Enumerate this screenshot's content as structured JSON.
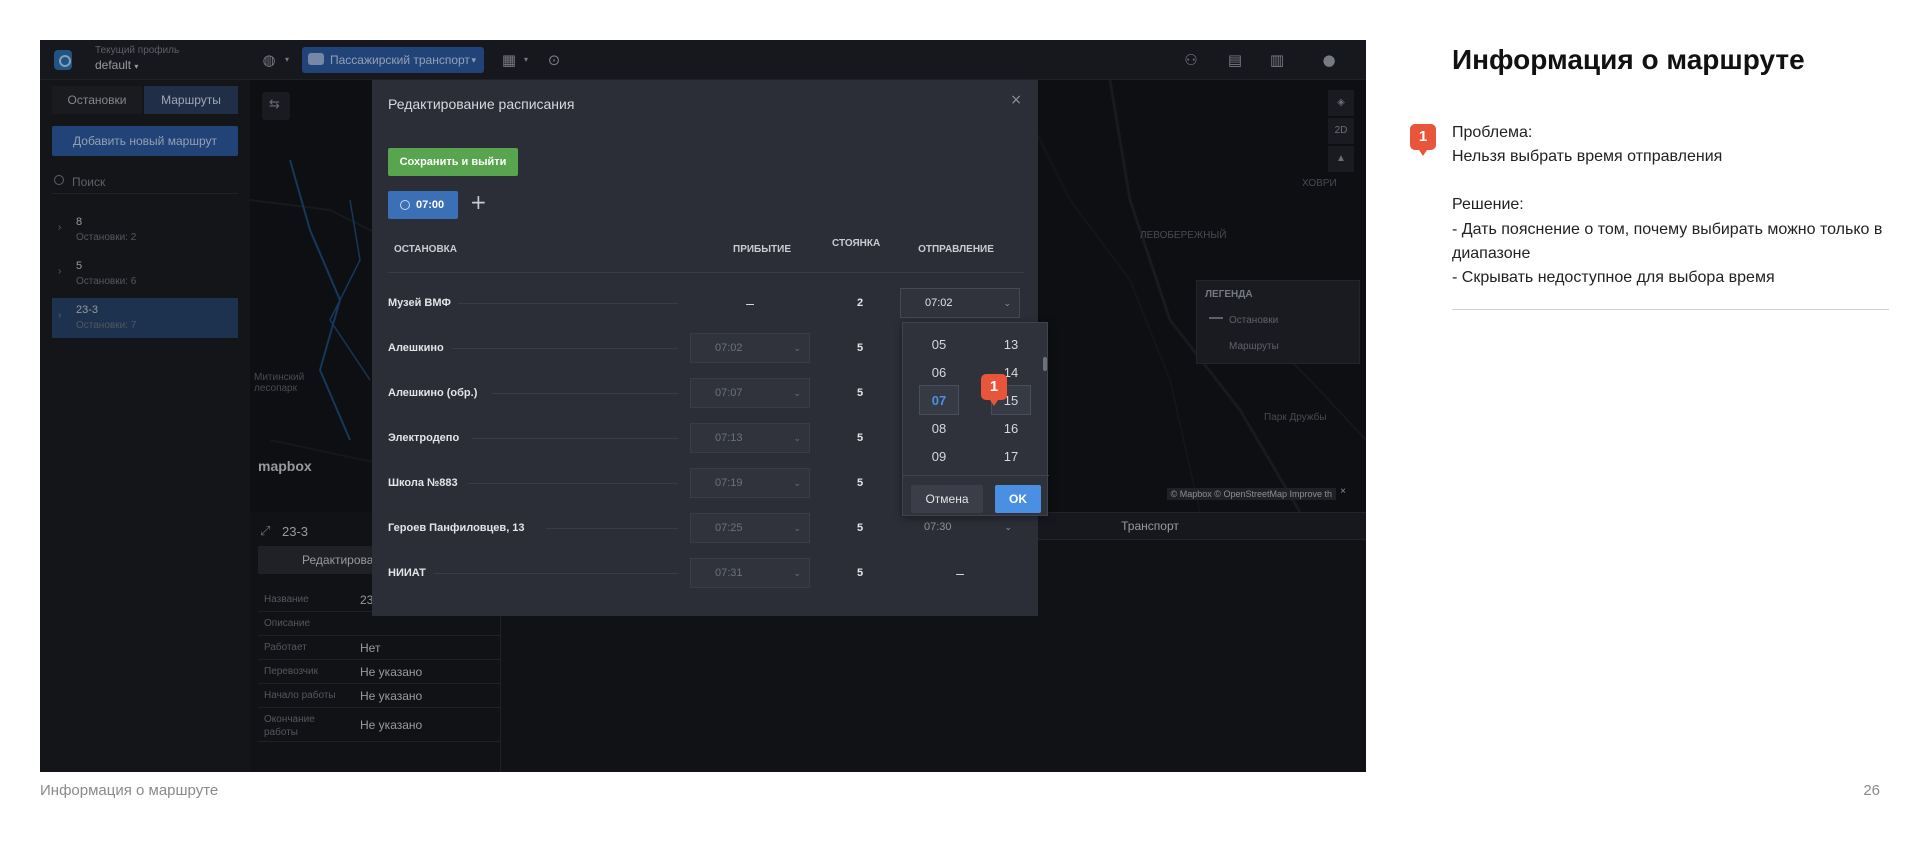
{
  "app": {
    "profile_caption": "Текущий профиль",
    "profile_value": "default",
    "transport_select": "Пассажирский транспорт",
    "icons": [
      "globe-icon",
      "bus-icon",
      "grid-icon",
      "car-search-icon",
      "users-icon",
      "archive-icon",
      "clipboard-icon",
      "user-icon"
    ]
  },
  "sidebar": {
    "tabs": [
      {
        "label": "Остановки",
        "active": false
      },
      {
        "label": "Маршруты",
        "active": true
      }
    ],
    "add_route_label": "Добавить новый маршрут",
    "search_placeholder": "Поиск",
    "routes": [
      {
        "num": "8",
        "sub": "Остановки: 2",
        "selected": false
      },
      {
        "num": "5",
        "sub": "Остановки: 6",
        "selected": false
      },
      {
        "num": "23-3",
        "sub": "Остановки: 7",
        "selected": true
      }
    ]
  },
  "map": {
    "labels": [
      "Митинский лесопарк",
      "ЛЕВОБЕРЕЖНЫЙ",
      "ХОВРИ",
      "Парк Дружбы"
    ],
    "zoom_mode": "2D",
    "legend": {
      "title": "ЛЕГЕНДА",
      "items": [
        "Остановки",
        "Маршруты"
      ]
    },
    "logo": "mapbox",
    "attribution": "© Mapbox © OpenStreetMap Improve th",
    "attribution_close": "×"
  },
  "route_panel": {
    "code": "23-3",
    "edit_label": "Редактирова",
    "transport_tab": "Транспорт",
    "fields": [
      {
        "key": "Название",
        "value": "23"
      },
      {
        "key": "Описание",
        "value": ""
      },
      {
        "key": "Работает",
        "value": "Нет"
      },
      {
        "key": "Перевозчик",
        "value": "Не указано"
      },
      {
        "key": "Начало работы",
        "value": "Не указано"
      },
      {
        "key": "Окончание работы",
        "value": "Не указано"
      }
    ]
  },
  "modal": {
    "title": "Редактирование расписания",
    "close": "×",
    "save_label": "Сохранить и выйти",
    "time_chip": "07:00",
    "add_time": "+",
    "headers": {
      "stop": "ОСТАНОВКА",
      "arrival": "ПРИБЫТИЕ",
      "stay": "СТОЯНКА",
      "departure": "ОТПРАВЛЕНИЕ"
    },
    "rows": [
      {
        "name": "Музей ВМФ",
        "arrival": "–",
        "stay": "2",
        "departure": "07:02"
      },
      {
        "name": "Алешкино",
        "arrival": "07:02",
        "stay": "5",
        "departure": ""
      },
      {
        "name": "Алешкино (обр.)",
        "arrival": "07:07",
        "stay": "5",
        "departure": ""
      },
      {
        "name": "Электродепо",
        "arrival": "07:13",
        "stay": "5",
        "departure": ""
      },
      {
        "name": "Школа №883",
        "arrival": "07:19",
        "stay": "5",
        "departure": ""
      },
      {
        "name": "Героев Панфиловцев, 13",
        "arrival": "07:25",
        "stay": "5",
        "departure": "07:30"
      },
      {
        "name": "НИИАТ",
        "arrival": "07:31",
        "stay": "5",
        "departure": "–"
      }
    ]
  },
  "picker": {
    "hours": [
      "05",
      "06",
      "07",
      "08",
      "09"
    ],
    "selected_hour": "07",
    "minutes": [
      "13",
      "14",
      "15",
      "16",
      "17"
    ],
    "cancel_label": "Отмена",
    "ok_label": "OK"
  },
  "markers": {
    "label": "1"
  },
  "doc": {
    "title": "Информация о маршруте",
    "marker": "1",
    "problem_caption": "Проблема:",
    "problem_text": "Нельзя выбрать время отправления",
    "solution_caption": "Решение:",
    "solution_items": [
      "- Дать пояснение о том, почему выбирать можно только в диапазоне",
      "- Скрывать недоступное для выбора время"
    ]
  },
  "footer": {
    "left": "Информация о маршруте",
    "page": "26"
  }
}
